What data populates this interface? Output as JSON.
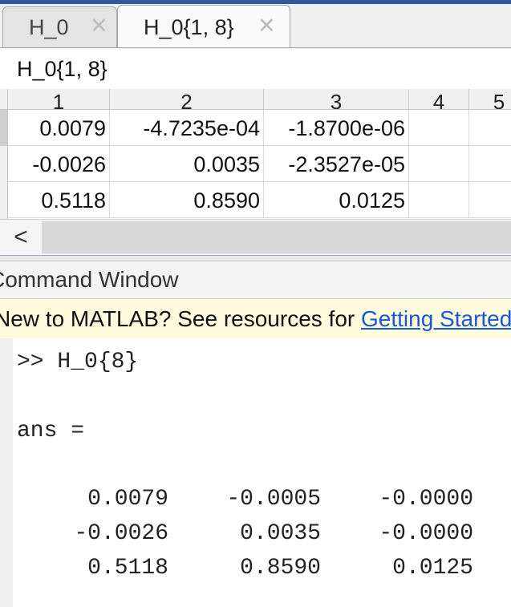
{
  "tabs": [
    {
      "label": "H_0",
      "close": "✕"
    },
    {
      "label": "H_0{1, 8}",
      "close": "✕"
    }
  ],
  "variable_name": "H_0{1, 8}",
  "columns": [
    "1",
    "2",
    "3",
    "4",
    "5"
  ],
  "rows": [
    [
      "0.0079",
      "-4.7235e-04",
      "-1.8700e-06",
      "",
      ""
    ],
    [
      "-0.0026",
      "0.0035",
      "-2.3527e-05",
      "",
      ""
    ],
    [
      "0.5118",
      "0.8590",
      "0.0125",
      "",
      ""
    ]
  ],
  "scroll_left_glyph": "<",
  "command_window": {
    "title": "Command Window",
    "banner_text": "New to MATLAB? See resources for ",
    "banner_link": "Getting Started",
    "command": ">> H_0{8}",
    "ans_label": "ans =",
    "output": [
      [
        "0.0079",
        "-0.0005",
        "-0.0000"
      ],
      [
        "-0.0026",
        "0.0035",
        "-0.0000"
      ],
      [
        "0.5118",
        "0.8590",
        "0.0125"
      ]
    ]
  }
}
